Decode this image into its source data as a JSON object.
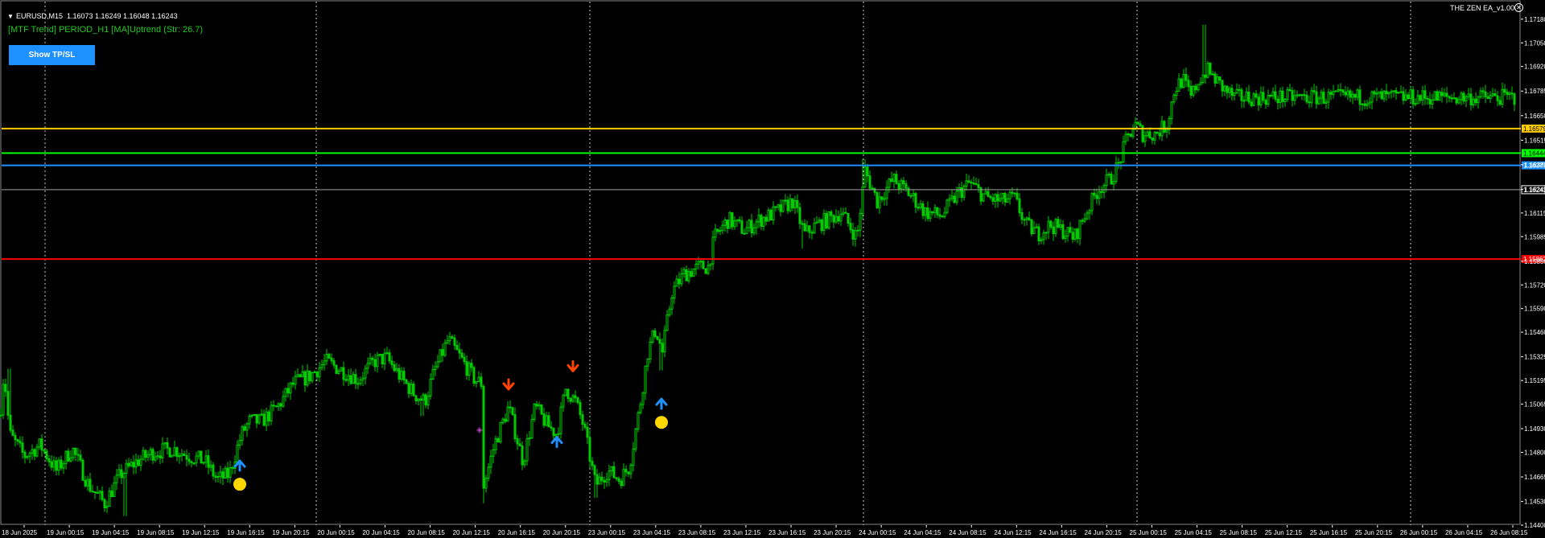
{
  "header": {
    "symbol": "EURUSD,M15",
    "ohlc": "1.16073 1.16249 1.16048 1.16243"
  },
  "indicator": {
    "mtf_label": "[MTF Trend] PERIOD_H1 [MA]Uptrend (Str: 26.7)",
    "ea_name": "THE ZEN EA_v1.00",
    "close_symbol": "✕"
  },
  "buttons": {
    "tpsl_label": "Show TP/SL"
  },
  "colors": {
    "background": "#000000",
    "candles": "#00cc00",
    "grid": "#c8c8c8",
    "axis_text": "#ffffff",
    "line_yellow": "#ffcc00",
    "line_green": "#00ff00",
    "line_blue": "#1e90ff",
    "line_gray": "#a0a0a0",
    "line_red": "#ff0000",
    "arrow_up": "#1e90ff",
    "arrow_down": "#ff4500",
    "dot": "#ffd700",
    "button": "#1e90ff",
    "mtf_text": "#1ec81e"
  },
  "chart_data": {
    "type": "candlestick",
    "symbol": "EURUSD",
    "timeframe": "M15",
    "ylim": [
      1.144,
      1.1725
    ],
    "price_ticks": [
      "1.17180",
      "1.17050",
      "1.16920",
      "1.16785",
      "1.16650",
      "1.16515",
      "1.16380",
      "1.16245",
      "1.16115",
      "1.15985",
      "1.15850",
      "1.15720",
      "1.15590",
      "1.15460",
      "1.15325",
      "1.15195",
      "1.15065",
      "1.14930",
      "1.14800",
      "1.14665",
      "1.14530",
      "1.14400"
    ],
    "time_ticks": [
      "18 Jun 2025",
      "19 Jun 00:15",
      "19 Jun 04:15",
      "19 Jun 08:15",
      "19 Jun 12:15",
      "19 Jun 16:15",
      "19 Jun 20:15",
      "20 Jun 00:15",
      "20 Jun 04:15",
      "20 Jun 08:15",
      "20 Jun 12:15",
      "20 Jun 16:15",
      "20 Jun 20:15",
      "23 Jun 00:15",
      "23 Jun 04:15",
      "23 Jun 08:15",
      "23 Jun 12:15",
      "23 Jun 16:15",
      "23 Jun 20:15",
      "24 Jun 00:15",
      "24 Jun 04:15",
      "24 Jun 08:15",
      "24 Jun 12:15",
      "24 Jun 16:15",
      "24 Jun 20:15",
      "25 Jun 00:15",
      "25 Jun 04:15",
      "25 Jun 08:15",
      "25 Jun 12:15",
      "25 Jun 16:15",
      "25 Jun 20:15",
      "26 Jun 00:15",
      "26 Jun 04:15",
      "26 Jun 08:15"
    ],
    "anchors": [
      [
        0,
        1.15
      ],
      [
        5,
        1.1525
      ],
      [
        12,
        1.149
      ],
      [
        30,
        1.1478
      ],
      [
        50,
        1.1484
      ],
      [
        70,
        1.147
      ],
      [
        90,
        1.1482
      ],
      [
        110,
        1.1462
      ],
      [
        130,
        1.1452
      ],
      [
        150,
        1.1468
      ],
      [
        170,
        1.1475
      ],
      [
        190,
        1.148
      ],
      [
        215,
        1.1482
      ],
      [
        235,
        1.1478
      ],
      [
        255,
        1.1475
      ],
      [
        270,
        1.1465
      ],
      [
        285,
        1.1468
      ],
      [
        300,
        1.149
      ],
      [
        310,
        1.1497
      ],
      [
        325,
        1.1497
      ],
      [
        345,
        1.1505
      ],
      [
        365,
        1.1518
      ],
      [
        385,
        1.1522
      ],
      [
        405,
        1.153
      ],
      [
        425,
        1.1525
      ],
      [
        445,
        1.152
      ],
      [
        465,
        1.153
      ],
      [
        480,
        1.1532
      ],
      [
        500,
        1.152
      ],
      [
        515,
        1.1512
      ],
      [
        528,
        1.1508
      ],
      [
        540,
        1.1525
      ],
      [
        557,
        1.1542
      ],
      [
        575,
        1.153
      ],
      [
        590,
        1.152
      ],
      [
        598,
        1.1518
      ],
      [
        601,
        1.1462
      ],
      [
        615,
        1.1485
      ],
      [
        632,
        1.1505
      ],
      [
        650,
        1.1475
      ],
      [
        665,
        1.1505
      ],
      [
        680,
        1.1495
      ],
      [
        692,
        1.149
      ],
      [
        703,
        1.1515
      ],
      [
        715,
        1.1508
      ],
      [
        725,
        1.1495
      ],
      [
        740,
        1.1462
      ],
      [
        755,
        1.147
      ],
      [
        770,
        1.1465
      ],
      [
        782,
        1.1472
      ],
      [
        795,
        1.1505
      ],
      [
        805,
        1.1535
      ],
      [
        815,
        1.1548
      ],
      [
        823,
        1.1535
      ],
      [
        835,
        1.1568
      ],
      [
        850,
        1.1578
      ],
      [
        870,
        1.1582
      ],
      [
        880,
        1.1582
      ],
      [
        888,
        1.1598
      ],
      [
        905,
        1.1608
      ],
      [
        925,
        1.1602
      ],
      [
        945,
        1.1608
      ],
      [
        965,
        1.1612
      ],
      [
        985,
        1.1618
      ],
      [
        1000,
        1.16
      ],
      [
        1015,
        1.1605
      ],
      [
        1030,
        1.1608
      ],
      [
        1045,
        1.1612
      ],
      [
        1065,
        1.1598
      ],
      [
        1075,
        1.1635
      ],
      [
        1090,
        1.1618
      ],
      [
        1110,
        1.163
      ],
      [
        1130,
        1.1622
      ],
      [
        1150,
        1.1612
      ],
      [
        1170,
        1.161
      ],
      [
        1190,
        1.1622
      ],
      [
        1205,
        1.1628
      ],
      [
        1225,
        1.162
      ],
      [
        1245,
        1.1618
      ],
      [
        1260,
        1.162
      ],
      [
        1275,
        1.1605
      ],
      [
        1290,
        1.16
      ],
      [
        1305,
        1.1605
      ],
      [
        1320,
        1.1602
      ],
      [
        1335,
        1.1598
      ],
      [
        1350,
        1.1612
      ],
      [
        1365,
        1.1625
      ],
      [
        1380,
        1.163
      ],
      [
        1390,
        1.1638
      ],
      [
        1400,
        1.1652
      ],
      [
        1410,
        1.166
      ],
      [
        1420,
        1.1655
      ],
      [
        1435,
        1.1655
      ],
      [
        1450,
        1.166
      ],
      [
        1460,
        1.168
      ],
      [
        1470,
        1.1685
      ],
      [
        1480,
        1.1675
      ],
      [
        1490,
        1.1685
      ],
      [
        1500,
        1.169
      ],
      [
        1510,
        1.1685
      ],
      [
        1520,
        1.168
      ],
      [
        1534,
        1.1675
      ]
    ],
    "spikes": [
      [
        11,
        1.1526,
        "high"
      ],
      [
        1497,
        1.1715,
        "high"
      ],
      [
        822,
        1.1525,
        "low"
      ],
      [
        1074,
        1.1641,
        "high"
      ],
      [
        997,
        1.1592,
        "low"
      ],
      [
        1063,
        1.1593,
        "low"
      ],
      [
        155,
        1.1445,
        "low"
      ],
      [
        525,
        1.15,
        "low"
      ],
      [
        740,
        1.1455,
        "low"
      ],
      [
        601,
        1.1452,
        "low"
      ]
    ],
    "horizontal_lines": [
      {
        "price": 1.16579,
        "color": "#ffcc00",
        "label": "1.16579"
      },
      {
        "price": 1.16444,
        "color": "#00ff00",
        "label": "1.16444"
      },
      {
        "price": 1.16377,
        "color": "#1e90ff",
        "label": "1.16377"
      },
      {
        "price": 1.16243,
        "color": "#a0a0a0",
        "label": "1.16243"
      },
      {
        "price": 1.15862,
        "color": "#ff0000",
        "label": "1.15862"
      }
    ],
    "signals": [
      {
        "type": "buy",
        "bar_x": 298,
        "price": 1.1474,
        "dot_price": 1.1466
      },
      {
        "type": "sell",
        "bar_x": 632,
        "price": 1.1516
      },
      {
        "type": "buy",
        "bar_x": 692,
        "price": 1.1487
      },
      {
        "type": "sell",
        "bar_x": 712,
        "price": 1.1526
      },
      {
        "type": "buy",
        "bar_x": 822,
        "price": 1.1508,
        "dot_price": 1.15
      }
    ],
    "grid": "vertical dotted"
  }
}
